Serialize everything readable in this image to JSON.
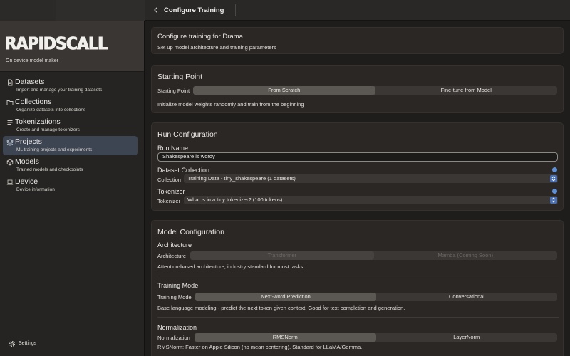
{
  "app": {
    "logo_text": "RAPIDSCALL",
    "tagline": "On device model maker"
  },
  "sidebar": {
    "items": [
      {
        "label": "Datasets",
        "desc": "Import and manage your training datasets",
        "icon": "document-icon"
      },
      {
        "label": "Collections",
        "desc": "Organize datasets into collections",
        "icon": "folder-icon"
      },
      {
        "label": "Tokenizations",
        "desc": "Create and manage tokenizers",
        "icon": "list-icon"
      },
      {
        "label": "Projects",
        "desc": "ML training projects and experiments",
        "icon": "layers-icon"
      },
      {
        "label": "Models",
        "desc": "Trained models and checkpoints",
        "icon": "cube-icon"
      },
      {
        "label": "Device",
        "desc": "Device information",
        "icon": "laptop-icon"
      }
    ],
    "active_index": 3,
    "settings_label": "Settings"
  },
  "header": {
    "title": "Configure Training"
  },
  "intro": {
    "title": "Configure training for Drama",
    "subtitle": "Set up model architecture and training parameters"
  },
  "starting_point": {
    "title": "Starting Point",
    "label": "Starting Point",
    "options": [
      "From Scratch",
      "Fine-tune from Model"
    ],
    "selected": "From Scratch",
    "description": "Initialize model weights randomly and train from the beginning"
  },
  "run_config": {
    "title": "Run Configuration",
    "run_name_label": "Run Name",
    "run_name_value": "Shakespeare is wordy",
    "dataset_section": "Dataset Collection",
    "collection_label": "Collection",
    "collection_value": "Training Data - tiny_shakespeare (1 datasets)",
    "tokenizer_section": "Tokenizer",
    "tokenizer_label": "Tokenizer",
    "tokenizer_value": "What is in a tiny tokenizer? (100 tokens)"
  },
  "model_config": {
    "title": "Model Configuration",
    "architecture": {
      "title": "Architecture",
      "label": "Architecture",
      "options": [
        "Transformer",
        "Mamba (Coming Soon)"
      ],
      "selected": "Transformer",
      "description": "Attention-based architecture, industry standard for most tasks"
    },
    "training_mode": {
      "title": "Training Mode",
      "label": "Training Mode",
      "options": [
        "Next-word Prediction",
        "Conversational"
      ],
      "selected": "Next-word Prediction",
      "description": "Base language modeling - predict the next token given context. Good for text completion and generation."
    },
    "normalization": {
      "title": "Normalization",
      "label": "Normalization",
      "options": [
        "RMSNorm",
        "LayerNorm"
      ],
      "selected": "RMSNorm",
      "description": "RMSNorm: Faster on Apple Silicon (no mean centering). Standard for LLaMA/Gemma."
    }
  },
  "colors": {
    "accent": "#5d8fd8",
    "active_nav": "#3d4452",
    "selected_segment": "#5b5753"
  }
}
